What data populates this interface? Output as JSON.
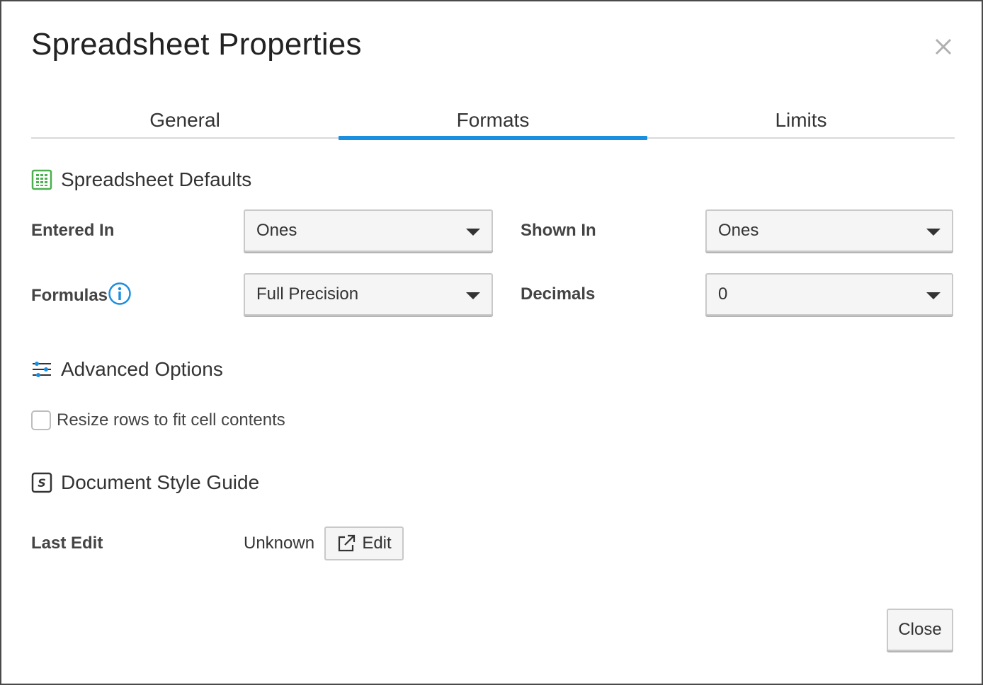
{
  "dialog": {
    "title": "Spreadsheet Properties",
    "close_icon": "close-icon"
  },
  "tabs": [
    {
      "label": "General",
      "active": false
    },
    {
      "label": "Formats",
      "active": true
    },
    {
      "label": "Limits",
      "active": false
    }
  ],
  "colors": {
    "accent": "#1a8fe0",
    "spreadsheet_icon": "#4caf50",
    "border": "#4a4a4a"
  },
  "defaults_section": {
    "title": "Spreadsheet Defaults",
    "icon": "spreadsheet-icon",
    "entered_in": {
      "label": "Entered In",
      "value": "Ones"
    },
    "shown_in": {
      "label": "Shown In",
      "value": "Ones"
    },
    "formulas": {
      "label": "Formulas",
      "value": "Full Precision",
      "info_icon": "info-icon"
    },
    "decimals": {
      "label": "Decimals",
      "value": "0"
    }
  },
  "advanced_section": {
    "title": "Advanced Options",
    "icon": "sliders-icon",
    "resize_rows": {
      "label": "Resize rows to fit cell contents",
      "checked": false
    }
  },
  "style_guide_section": {
    "title": "Document Style Guide",
    "icon": "style-guide-icon",
    "last_edit": {
      "label": "Last Edit",
      "value": "Unknown"
    },
    "edit_button": {
      "label": "Edit",
      "icon": "external-link-icon"
    }
  },
  "footer": {
    "close_label": "Close"
  }
}
